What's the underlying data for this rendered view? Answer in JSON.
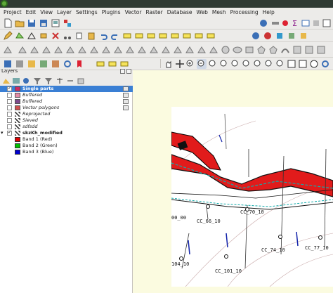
{
  "menu": [
    "Project",
    "Edit",
    "View",
    "Layer",
    "Settings",
    "Plugins",
    "Vector",
    "Raster",
    "Database",
    "Web",
    "Mesh",
    "Processing",
    "Help"
  ],
  "layers_panel": {
    "title": "Layers",
    "items": [
      {
        "label": "Single parts",
        "checked": true,
        "selected": true,
        "italic": false,
        "bold": true,
        "symbol": "fill",
        "color": "#cc2a64",
        "expander": false
      },
      {
        "label": "Buffered",
        "checked": false,
        "selected": false,
        "italic": true,
        "bold": false,
        "symbol": "fill",
        "color": "#e48aa6",
        "expander": false
      },
      {
        "label": "Buffered",
        "checked": false,
        "selected": false,
        "italic": true,
        "bold": false,
        "symbol": "fill",
        "color": "#7e4a8c",
        "expander": false
      },
      {
        "label": "Vector polygons",
        "checked": false,
        "selected": false,
        "italic": true,
        "bold": false,
        "symbol": "fill",
        "color": "#d05050",
        "expander": false
      },
      {
        "label": "Reprojected",
        "checked": false,
        "selected": false,
        "italic": true,
        "bold": false,
        "symbol": "raster",
        "color": "#444444",
        "expander": false
      },
      {
        "label": "Sieved",
        "checked": false,
        "selected": false,
        "italic": true,
        "bold": false,
        "symbol": "raster",
        "color": "#444444",
        "expander": false
      },
      {
        "label": "sdfsdd",
        "checked": false,
        "selected": false,
        "italic": true,
        "bold": false,
        "symbol": "raster",
        "color": "#444444",
        "expander": false
      },
      {
        "label": "skzKh_modified",
        "checked": true,
        "selected": false,
        "italic": false,
        "bold": true,
        "symbol": "raster",
        "color": "#444444",
        "expander": true
      }
    ],
    "bands": [
      {
        "label": "Band 1 (Red)",
        "color": "#e00000"
      },
      {
        "label": "Band 2 (Green)",
        "color": "#00c000"
      },
      {
        "label": "Band 3 (Blue)",
        "color": "#0000d0"
      }
    ]
  },
  "map": {
    "background_color": "#fbfbe0",
    "labels": [
      "00_00",
      "CC_66_10",
      "CC_70_10",
      "CC_74_10",
      "CC_77_10",
      "CC_101_10",
      "104_10"
    ]
  }
}
